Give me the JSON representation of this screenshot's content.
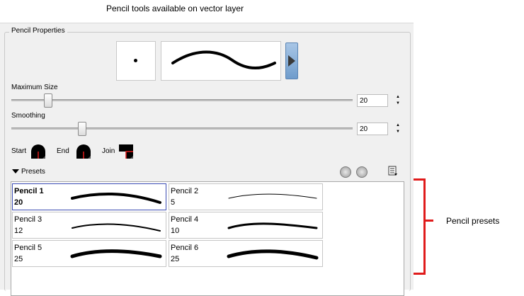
{
  "caption": "Pencil tools available on vector layer",
  "panel": {
    "title": "Pencil Properties",
    "maximum_size": {
      "label": "Maximum Size",
      "value": "20"
    },
    "smoothing": {
      "label": "Smoothing",
      "value": "20"
    },
    "caps": {
      "start_label": "Start",
      "end_label": "End",
      "join_label": "Join"
    },
    "presets_label": "Presets"
  },
  "presets": [
    {
      "name": "Pencil 1",
      "value": "20",
      "selected": true
    },
    {
      "name": "Pencil 2",
      "value": "5",
      "selected": false
    },
    {
      "name": "Pencil 3",
      "value": "12",
      "selected": false
    },
    {
      "name": "Pencil 4",
      "value": "10",
      "selected": false
    },
    {
      "name": "Pencil 5",
      "value": "25",
      "selected": false
    },
    {
      "name": "Pencil 6",
      "value": "25",
      "selected": false
    }
  ],
  "annotation": {
    "label": "Pencil presets",
    "color": "#e01b1b"
  },
  "colors": {
    "selection_border": "#3a4bb3",
    "button_accent": "#7aa3d0"
  }
}
